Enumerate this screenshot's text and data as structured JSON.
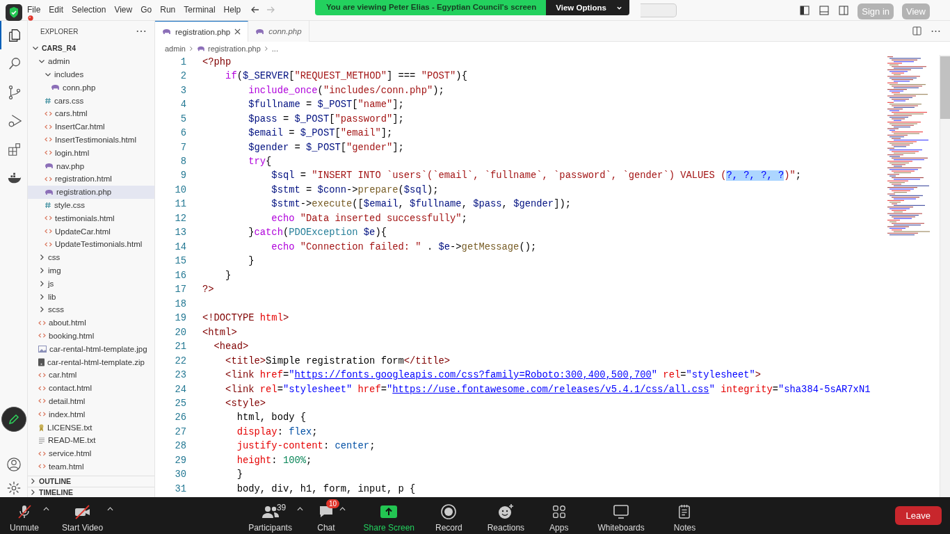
{
  "menu": [
    "File",
    "Edit",
    "Selection",
    "View",
    "Go",
    "Run",
    "Terminal",
    "Help"
  ],
  "zoom_banner": {
    "text": "You are viewing Peter Elias - Egyptian Council's screen",
    "button": "View Options"
  },
  "overlay_buttons": [
    "Sign in",
    "View"
  ],
  "activity_bar": [
    {
      "kind": "files",
      "selected": true
    },
    {
      "kind": "search",
      "selected": false
    },
    {
      "kind": "git",
      "selected": false
    },
    {
      "kind": "debug",
      "selected": false
    },
    {
      "kind": "extensions",
      "selected": false
    },
    {
      "kind": "docker",
      "selected": false
    }
  ],
  "explorer": {
    "title": "EXPLORER",
    "tree": [
      {
        "name": "CARS_R4",
        "kind": "root",
        "expanded": true,
        "selected": false,
        "children": [
          {
            "name": "admin",
            "kind": "folder",
            "expanded": true,
            "selected": false,
            "children": [
              {
                "name": "includes",
                "kind": "folder",
                "expanded": true,
                "selected": false,
                "children": [
                  {
                    "name": "conn.php",
                    "kind": "php",
                    "selected": false
                  }
                ]
              },
              {
                "name": "cars.css",
                "kind": "css",
                "selected": false
              },
              {
                "name": "cars.html",
                "kind": "html",
                "selected": false
              },
              {
                "name": "InsertCar.html",
                "kind": "html",
                "selected": false
              },
              {
                "name": "InsertTestimonials.html",
                "kind": "html",
                "selected": false
              },
              {
                "name": "login.html",
                "kind": "html",
                "selected": false
              },
              {
                "name": "nav.php",
                "kind": "php",
                "selected": false
              },
              {
                "name": "registration.html",
                "kind": "html",
                "selected": false
              },
              {
                "name": "registration.php",
                "kind": "php",
                "selected": true
              },
              {
                "name": "style.css",
                "kind": "css",
                "selected": false
              },
              {
                "name": "testimonials.html",
                "kind": "html",
                "selected": false
              },
              {
                "name": "UpdateCar.html",
                "kind": "html",
                "selected": false
              },
              {
                "name": "UpdateTestimonials.html",
                "kind": "html",
                "selected": false
              }
            ]
          },
          {
            "name": "css",
            "kind": "folder",
            "expanded": false,
            "selected": false
          },
          {
            "name": "img",
            "kind": "folder",
            "expanded": false,
            "selected": false
          },
          {
            "name": "js",
            "kind": "folder",
            "expanded": false,
            "selected": false
          },
          {
            "name": "lib",
            "kind": "folder",
            "expanded": false,
            "selected": false
          },
          {
            "name": "scss",
            "kind": "folder",
            "expanded": false,
            "selected": false
          },
          {
            "name": "about.html",
            "kind": "html",
            "selected": false
          },
          {
            "name": "booking.html",
            "kind": "html",
            "selected": false
          },
          {
            "name": "car-rental-html-template.jpg",
            "kind": "image",
            "selected": false
          },
          {
            "name": "car-rental-html-template.zip",
            "kind": "zip",
            "selected": false
          },
          {
            "name": "car.html",
            "kind": "html",
            "selected": false
          },
          {
            "name": "contact.html",
            "kind": "html",
            "selected": false
          },
          {
            "name": "detail.html",
            "kind": "html",
            "selected": false
          },
          {
            "name": "index.html",
            "kind": "html",
            "selected": false
          },
          {
            "name": "LICENSE.txt",
            "kind": "license",
            "selected": false
          },
          {
            "name": "READ-ME.txt",
            "kind": "text",
            "selected": false
          },
          {
            "name": "service.html",
            "kind": "html",
            "selected": false
          },
          {
            "name": "team.html",
            "kind": "html",
            "selected": false
          }
        ]
      }
    ],
    "sections": [
      {
        "title": "OUTLINE",
        "expanded": false
      },
      {
        "title": "TIMELINE",
        "expanded": false
      }
    ]
  },
  "tabs": [
    {
      "label": "registration.php",
      "selected": true,
      "preview": false
    },
    {
      "label": "conn.php",
      "selected": false,
      "preview": true
    }
  ],
  "breadcrumb": [
    {
      "text": "admin",
      "kind": "folder"
    },
    {
      "text": "registration.php",
      "kind": "php"
    },
    {
      "text": "...",
      "kind": "more"
    }
  ],
  "code": [
    {
      "n": "1",
      "tokens": [
        {
          "kind": "tag",
          "text": "<?php"
        }
      ]
    },
    {
      "n": "2",
      "tokens": [
        {
          "kind": "kw",
          "text": "    if"
        },
        {
          "kind": "p",
          "text": "("
        },
        {
          "kind": "var",
          "text": "$_SERVER"
        },
        {
          "kind": "p",
          "text": "["
        },
        {
          "kind": "str",
          "text": "\"REQUEST_METHOD\""
        },
        {
          "kind": "p",
          "text": "] === "
        },
        {
          "kind": "str",
          "text": "\"POST\""
        },
        {
          "kind": "p",
          "text": "){"
        }
      ]
    },
    {
      "n": "3",
      "tokens": [
        {
          "kind": "kw",
          "text": "        include_once"
        },
        {
          "kind": "p",
          "text": "("
        },
        {
          "kind": "str",
          "text": "\"includes/conn.php\""
        },
        {
          "kind": "p",
          "text": ");"
        }
      ]
    },
    {
      "n": "4",
      "tokens": [
        {
          "kind": "var",
          "text": "        $fullname"
        },
        {
          "kind": "p",
          "text": " = "
        },
        {
          "kind": "var",
          "text": "$_POST"
        },
        {
          "kind": "p",
          "text": "["
        },
        {
          "kind": "str",
          "text": "\"name\""
        },
        {
          "kind": "p",
          "text": "];"
        }
      ]
    },
    {
      "n": "5",
      "tokens": [
        {
          "kind": "var",
          "text": "        $pass"
        },
        {
          "kind": "p",
          "text": " = "
        },
        {
          "kind": "var",
          "text": "$_POST"
        },
        {
          "kind": "p",
          "text": "["
        },
        {
          "kind": "str",
          "text": "\"password\""
        },
        {
          "kind": "p",
          "text": "];"
        }
      ]
    },
    {
      "n": "6",
      "tokens": [
        {
          "kind": "var",
          "text": "        $email"
        },
        {
          "kind": "p",
          "text": " = "
        },
        {
          "kind": "var",
          "text": "$_POST"
        },
        {
          "kind": "p",
          "text": "["
        },
        {
          "kind": "str",
          "text": "\"email\""
        },
        {
          "kind": "p",
          "text": "];"
        }
      ]
    },
    {
      "n": "7",
      "tokens": [
        {
          "kind": "var",
          "text": "        $gender"
        },
        {
          "kind": "p",
          "text": " = "
        },
        {
          "kind": "var",
          "text": "$_POST"
        },
        {
          "kind": "p",
          "text": "["
        },
        {
          "kind": "str",
          "text": "\"gender\""
        },
        {
          "kind": "p",
          "text": "];"
        }
      ]
    },
    {
      "n": "8",
      "tokens": [
        {
          "kind": "kw",
          "text": "        try"
        },
        {
          "kind": "p",
          "text": "{"
        }
      ]
    },
    {
      "n": "9",
      "tokens": [
        {
          "kind": "var",
          "text": "            $sql"
        },
        {
          "kind": "p",
          "text": " = "
        },
        {
          "kind": "str",
          "text": "\"INSERT INTO `users`(`email`, `fullname`, `password`, `gender`) VALUES ("
        },
        {
          "kind": "sel",
          "text": "?, ?, ?, ?"
        },
        {
          "kind": "str",
          "text": ")\""
        },
        {
          "kind": "p",
          "text": ";"
        }
      ]
    },
    {
      "n": "10",
      "tokens": [
        {
          "kind": "var",
          "text": "            $stmt"
        },
        {
          "kind": "p",
          "text": " = "
        },
        {
          "kind": "var",
          "text": "$conn"
        },
        {
          "kind": "p",
          "text": "->"
        },
        {
          "kind": "fn",
          "text": "prepare"
        },
        {
          "kind": "p",
          "text": "("
        },
        {
          "kind": "var",
          "text": "$sql"
        },
        {
          "kind": "p",
          "text": ");"
        }
      ]
    },
    {
      "n": "11",
      "tokens": [
        {
          "kind": "var",
          "text": "            $stmt"
        },
        {
          "kind": "p",
          "text": "->"
        },
        {
          "kind": "fn",
          "text": "execute"
        },
        {
          "kind": "p",
          "text": "(["
        },
        {
          "kind": "var",
          "text": "$email"
        },
        {
          "kind": "p",
          "text": ", "
        },
        {
          "kind": "var",
          "text": "$fullname"
        },
        {
          "kind": "p",
          "text": ", "
        },
        {
          "kind": "var",
          "text": "$pass"
        },
        {
          "kind": "p",
          "text": ", "
        },
        {
          "kind": "var",
          "text": "$gender"
        },
        {
          "kind": "p",
          "text": "]);"
        }
      ]
    },
    {
      "n": "12",
      "tokens": [
        {
          "kind": "kw",
          "text": "            echo"
        },
        {
          "kind": "str",
          "text": " \"Data inserted successfully\""
        },
        {
          "kind": "p",
          "text": ";"
        }
      ]
    },
    {
      "n": "13",
      "tokens": [
        {
          "kind": "p",
          "text": "        }"
        },
        {
          "kind": "kw",
          "text": "catch"
        },
        {
          "kind": "p",
          "text": "("
        },
        {
          "kind": "cls",
          "text": "PDOException"
        },
        {
          "kind": "var",
          "text": " $e"
        },
        {
          "kind": "p",
          "text": "){"
        }
      ]
    },
    {
      "n": "14",
      "tokens": [
        {
          "kind": "kw",
          "text": "            echo"
        },
        {
          "kind": "str",
          "text": " \"Connection failed: \""
        },
        {
          "kind": "p",
          "text": " . "
        },
        {
          "kind": "var",
          "text": "$e"
        },
        {
          "kind": "p",
          "text": "->"
        },
        {
          "kind": "fn",
          "text": "getMessage"
        },
        {
          "kind": "p",
          "text": "();"
        }
      ]
    },
    {
      "n": "15",
      "tokens": [
        {
          "kind": "p",
          "text": "        }"
        }
      ]
    },
    {
      "n": "16",
      "tokens": [
        {
          "kind": "p",
          "text": "    }"
        }
      ]
    },
    {
      "n": "17",
      "tokens": [
        {
          "kind": "tag",
          "text": "?>"
        }
      ]
    },
    {
      "n": "18"
    },
    {
      "n": "19",
      "tokens": [
        {
          "kind": "tag",
          "text": "<!DOCTYPE"
        },
        {
          "kind": "attr",
          "text": " html"
        },
        {
          "kind": "tag",
          "text": ">"
        }
      ]
    },
    {
      "n": "20",
      "tokens": [
        {
          "kind": "tag",
          "text": "<html>"
        }
      ]
    },
    {
      "n": "21",
      "tokens": [
        {
          "kind": "tag",
          "text": "  <head>"
        }
      ]
    },
    {
      "n": "22",
      "tokens": [
        {
          "kind": "tag",
          "text": "    <title>"
        },
        {
          "kind": "p",
          "text": "Simple registration form"
        },
        {
          "kind": "tag",
          "text": "</title>"
        }
      ]
    },
    {
      "n": "23",
      "tokens": [
        {
          "kind": "tag",
          "text": "    <link"
        },
        {
          "kind": "attr",
          "text": " href"
        },
        {
          "kind": "p",
          "text": "="
        },
        {
          "kind": "aval",
          "text": "\""
        },
        {
          "kind": "link",
          "text": "https://fonts.googleapis.com/css?family=Roboto:300,400,500,700"
        },
        {
          "kind": "aval",
          "text": "\""
        },
        {
          "kind": "attr",
          "text": " rel"
        },
        {
          "kind": "p",
          "text": "="
        },
        {
          "kind": "aval",
          "text": "\"stylesheet\""
        },
        {
          "kind": "tag",
          "text": ">"
        }
      ]
    },
    {
      "n": "24",
      "tokens": [
        {
          "kind": "tag",
          "text": "    <link"
        },
        {
          "kind": "attr",
          "text": " rel"
        },
        {
          "kind": "p",
          "text": "="
        },
        {
          "kind": "aval",
          "text": "\"stylesheet\""
        },
        {
          "kind": "attr",
          "text": " href"
        },
        {
          "kind": "p",
          "text": "="
        },
        {
          "kind": "aval",
          "text": "\""
        },
        {
          "kind": "link",
          "text": "https://use.fontawesome.com/releases/v5.4.1/css/all.css"
        },
        {
          "kind": "aval",
          "text": "\""
        },
        {
          "kind": "attr",
          "text": " integrity"
        },
        {
          "kind": "p",
          "text": "="
        },
        {
          "kind": "aval",
          "text": "\"sha384-5sAR7xN1"
        }
      ]
    },
    {
      "n": "25",
      "tokens": [
        {
          "kind": "tag",
          "text": "    <style>"
        }
      ]
    },
    {
      "n": "26",
      "tokens": [
        {
          "kind": "p",
          "text": "      html, body {"
        }
      ]
    },
    {
      "n": "27",
      "tokens": [
        {
          "kind": "prop",
          "text": "      display"
        },
        {
          "kind": "p",
          "text": ": "
        },
        {
          "kind": "val",
          "text": "flex"
        },
        {
          "kind": "p",
          "text": ";"
        }
      ]
    },
    {
      "n": "28",
      "tokens": [
        {
          "kind": "prop",
          "text": "      justify-content"
        },
        {
          "kind": "p",
          "text": ": "
        },
        {
          "kind": "val",
          "text": "center"
        },
        {
          "kind": "p",
          "text": ";"
        }
      ]
    },
    {
      "n": "29",
      "tokens": [
        {
          "kind": "prop",
          "text": "      height"
        },
        {
          "kind": "p",
          "text": ": "
        },
        {
          "kind": "num",
          "text": "100%"
        },
        {
          "kind": "p",
          "text": ";"
        }
      ]
    },
    {
      "n": "30",
      "tokens": [
        {
          "kind": "p",
          "text": "      }"
        }
      ]
    },
    {
      "n": "31",
      "tokens": [
        {
          "kind": "p",
          "text": "      body, div, h1, form, input, p {"
        }
      ]
    }
  ],
  "zoom_toolbar": [
    {
      "label": "Unmute",
      "kind": "mic-off",
      "menu": true
    },
    {
      "label": "Start Video",
      "kind": "video-off",
      "menu": true
    },
    {
      "label": "Participants",
      "kind": "people",
      "menu": true,
      "count": "39"
    },
    {
      "label": "Chat",
      "kind": "chat",
      "menu": true,
      "badge": "10"
    },
    {
      "label": "Share Screen",
      "kind": "share",
      "menu": false
    },
    {
      "label": "Record",
      "kind": "record",
      "menu": false
    },
    {
      "label": "Reactions",
      "kind": "reactions",
      "menu": false
    },
    {
      "label": "Apps",
      "kind": "apps",
      "menu": false
    },
    {
      "label": "Whiteboards",
      "kind": "whiteboard",
      "menu": false
    },
    {
      "label": "Notes",
      "kind": "notes",
      "menu": false
    }
  ],
  "leave_button": "Leave"
}
